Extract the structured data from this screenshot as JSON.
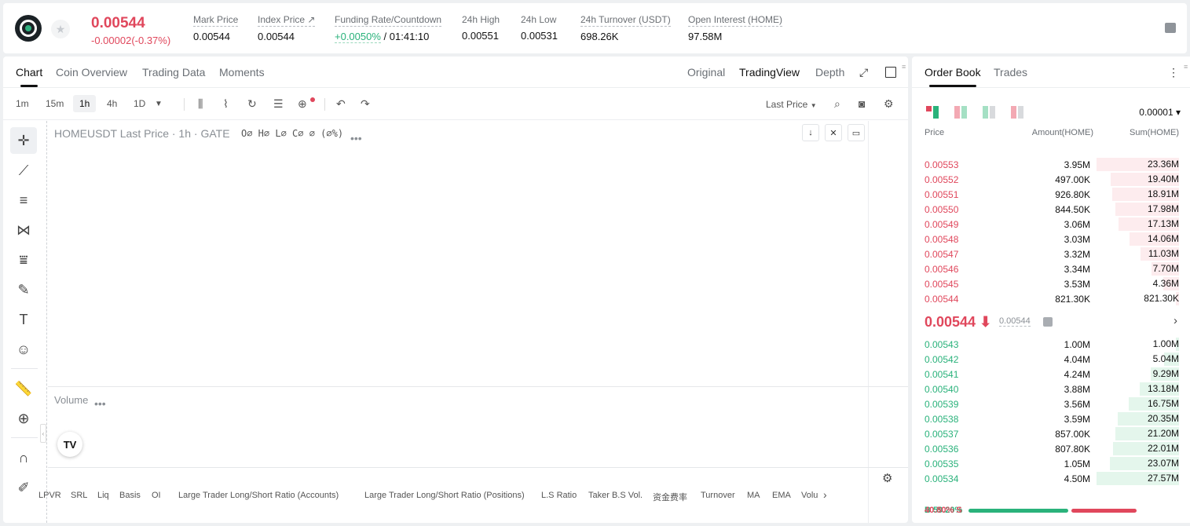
{
  "ticker": {
    "last_price": "0.00544",
    "change": "-0.00002(-0.37%)",
    "stats": [
      {
        "label": "Mark Price",
        "value": "0.00544"
      },
      {
        "label": "Index Price ↗",
        "value": "0.00544"
      },
      {
        "label": "Funding Rate/Countdown",
        "value_green": "+0.0050%",
        "value": "/ 01:41:10"
      },
      {
        "label": "24h High",
        "value": "0.00551"
      },
      {
        "label": "24h Low",
        "value": "0.00531"
      },
      {
        "label": "24h Turnover (USDT)",
        "value": "698.26K"
      },
      {
        "label": "Open Interest (HOME)",
        "value": "97.58M"
      }
    ]
  },
  "chart_tabs": [
    "Chart",
    "Coin Overview",
    "Trading Data",
    "Moments"
  ],
  "view_tabs": [
    "Original",
    "TradingView",
    "Depth"
  ],
  "timeframes": [
    "1m",
    "15m",
    "1h",
    "4h",
    "1D"
  ],
  "price_source": "Last Price",
  "legend": {
    "symbol": "HOMEUSDT Last Price · 1h · GATE",
    "ohlc": "O∅ H∅ L∅ C∅ ∅ (∅%)",
    "volume": "Volume"
  },
  "tv_logo": "TV",
  "indicators": [
    "LPVR",
    "SRL",
    "Liq",
    "Basis",
    "OI",
    "Large Trader Long/Short Ratio (Accounts)",
    "Large Trader Long/Short Ratio (Positions)",
    "L.S Ratio",
    "Taker B.S Vol.",
    "资金费率",
    "Turnover",
    "MA",
    "EMA",
    "Volu"
  ],
  "orderbook": {
    "tabs": [
      "Order Book",
      "Trades"
    ],
    "precision": "0.00001 ▾",
    "headers": [
      "Price",
      "Amount(HOME)",
      "Sum(HOME)"
    ],
    "asks": [
      {
        "price": "0.00553",
        "amount": "3.95M",
        "sum": "23.36M",
        "depth": 1.0
      },
      {
        "price": "0.00552",
        "amount": "497.00K",
        "sum": "19.40M",
        "depth": 0.83
      },
      {
        "price": "0.00551",
        "amount": "926.80K",
        "sum": "18.91M",
        "depth": 0.81
      },
      {
        "price": "0.00550",
        "amount": "844.50K",
        "sum": "17.98M",
        "depth": 0.77
      },
      {
        "price": "0.00549",
        "amount": "3.06M",
        "sum": "17.13M",
        "depth": 0.73
      },
      {
        "price": "0.00548",
        "amount": "3.03M",
        "sum": "14.06M",
        "depth": 0.6
      },
      {
        "price": "0.00547",
        "amount": "3.32M",
        "sum": "11.03M",
        "depth": 0.47
      },
      {
        "price": "0.00546",
        "amount": "3.34M",
        "sum": "7.70M",
        "depth": 0.33
      },
      {
        "price": "0.00545",
        "amount": "3.53M",
        "sum": "4.36M",
        "depth": 0.19
      },
      {
        "price": "0.00544",
        "amount": "821.30K",
        "sum": "821.30K",
        "depth": 0.04
      }
    ],
    "mid_price": "0.00544 ⬇",
    "mark_price": "0.00544",
    "bids": [
      {
        "price": "0.00543",
        "amount": "1.00M",
        "sum": "1.00M",
        "depth": 0.04
      },
      {
        "price": "0.00542",
        "amount": "4.04M",
        "sum": "5.04M",
        "depth": 0.18
      },
      {
        "price": "0.00541",
        "amount": "4.24M",
        "sum": "9.29M",
        "depth": 0.34
      },
      {
        "price": "0.00540",
        "amount": "3.88M",
        "sum": "13.18M",
        "depth": 0.48
      },
      {
        "price": "0.00539",
        "amount": "3.56M",
        "sum": "16.75M",
        "depth": 0.61
      },
      {
        "price": "0.00538",
        "amount": "3.59M",
        "sum": "20.35M",
        "depth": 0.74
      },
      {
        "price": "0.00537",
        "amount": "857.00K",
        "sum": "21.20M",
        "depth": 0.77
      },
      {
        "price": "0.00536",
        "amount": "807.80K",
        "sum": "22.01M",
        "depth": 0.8
      },
      {
        "price": "0.00535",
        "amount": "1.05M",
        "sum": "23.07M",
        "depth": 0.84
      },
      {
        "price": "0.00534",
        "amount": "4.50M",
        "sum": "27.57M",
        "depth": 1.0
      }
    ],
    "buy_ratio": "B 59.20%",
    "sell_ratio": "40.80% S",
    "buy_fraction": 0.592
  },
  "colors": {
    "up": "#2ab27b",
    "down": "#e0475c"
  }
}
